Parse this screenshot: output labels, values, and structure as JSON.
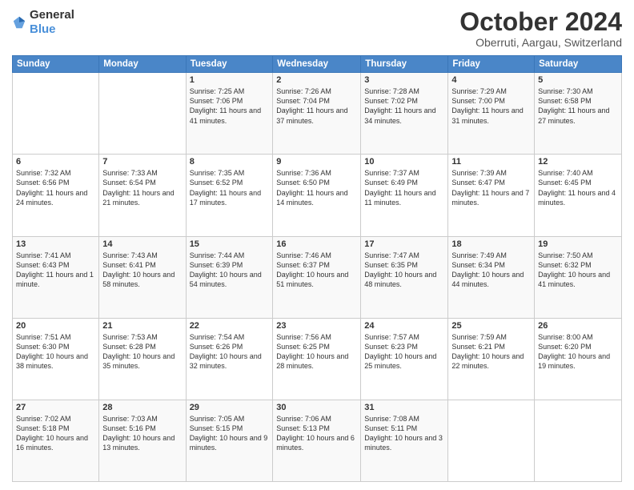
{
  "header": {
    "logo": {
      "general": "General",
      "blue": "Blue"
    },
    "title": "October 2024",
    "location": "Oberruti, Aargau, Switzerland"
  },
  "days_of_week": [
    "Sunday",
    "Monday",
    "Tuesday",
    "Wednesday",
    "Thursday",
    "Friday",
    "Saturday"
  ],
  "weeks": [
    [
      {
        "day": "",
        "sunrise": "",
        "sunset": "",
        "daylight": ""
      },
      {
        "day": "",
        "sunrise": "",
        "sunset": "",
        "daylight": ""
      },
      {
        "day": "1",
        "sunrise": "Sunrise: 7:25 AM",
        "sunset": "Sunset: 7:06 PM",
        "daylight": "Daylight: 11 hours and 41 minutes."
      },
      {
        "day": "2",
        "sunrise": "Sunrise: 7:26 AM",
        "sunset": "Sunset: 7:04 PM",
        "daylight": "Daylight: 11 hours and 37 minutes."
      },
      {
        "day": "3",
        "sunrise": "Sunrise: 7:28 AM",
        "sunset": "Sunset: 7:02 PM",
        "daylight": "Daylight: 11 hours and 34 minutes."
      },
      {
        "day": "4",
        "sunrise": "Sunrise: 7:29 AM",
        "sunset": "Sunset: 7:00 PM",
        "daylight": "Daylight: 11 hours and 31 minutes."
      },
      {
        "day": "5",
        "sunrise": "Sunrise: 7:30 AM",
        "sunset": "Sunset: 6:58 PM",
        "daylight": "Daylight: 11 hours and 27 minutes."
      }
    ],
    [
      {
        "day": "6",
        "sunrise": "Sunrise: 7:32 AM",
        "sunset": "Sunset: 6:56 PM",
        "daylight": "Daylight: 11 hours and 24 minutes."
      },
      {
        "day": "7",
        "sunrise": "Sunrise: 7:33 AM",
        "sunset": "Sunset: 6:54 PM",
        "daylight": "Daylight: 11 hours and 21 minutes."
      },
      {
        "day": "8",
        "sunrise": "Sunrise: 7:35 AM",
        "sunset": "Sunset: 6:52 PM",
        "daylight": "Daylight: 11 hours and 17 minutes."
      },
      {
        "day": "9",
        "sunrise": "Sunrise: 7:36 AM",
        "sunset": "Sunset: 6:50 PM",
        "daylight": "Daylight: 11 hours and 14 minutes."
      },
      {
        "day": "10",
        "sunrise": "Sunrise: 7:37 AM",
        "sunset": "Sunset: 6:49 PM",
        "daylight": "Daylight: 11 hours and 11 minutes."
      },
      {
        "day": "11",
        "sunrise": "Sunrise: 7:39 AM",
        "sunset": "Sunset: 6:47 PM",
        "daylight": "Daylight: 11 hours and 7 minutes."
      },
      {
        "day": "12",
        "sunrise": "Sunrise: 7:40 AM",
        "sunset": "Sunset: 6:45 PM",
        "daylight": "Daylight: 11 hours and 4 minutes."
      }
    ],
    [
      {
        "day": "13",
        "sunrise": "Sunrise: 7:41 AM",
        "sunset": "Sunset: 6:43 PM",
        "daylight": "Daylight: 11 hours and 1 minute."
      },
      {
        "day": "14",
        "sunrise": "Sunrise: 7:43 AM",
        "sunset": "Sunset: 6:41 PM",
        "daylight": "Daylight: 10 hours and 58 minutes."
      },
      {
        "day": "15",
        "sunrise": "Sunrise: 7:44 AM",
        "sunset": "Sunset: 6:39 PM",
        "daylight": "Daylight: 10 hours and 54 minutes."
      },
      {
        "day": "16",
        "sunrise": "Sunrise: 7:46 AM",
        "sunset": "Sunset: 6:37 PM",
        "daylight": "Daylight: 10 hours and 51 minutes."
      },
      {
        "day": "17",
        "sunrise": "Sunrise: 7:47 AM",
        "sunset": "Sunset: 6:35 PM",
        "daylight": "Daylight: 10 hours and 48 minutes."
      },
      {
        "day": "18",
        "sunrise": "Sunrise: 7:49 AM",
        "sunset": "Sunset: 6:34 PM",
        "daylight": "Daylight: 10 hours and 44 minutes."
      },
      {
        "day": "19",
        "sunrise": "Sunrise: 7:50 AM",
        "sunset": "Sunset: 6:32 PM",
        "daylight": "Daylight: 10 hours and 41 minutes."
      }
    ],
    [
      {
        "day": "20",
        "sunrise": "Sunrise: 7:51 AM",
        "sunset": "Sunset: 6:30 PM",
        "daylight": "Daylight: 10 hours and 38 minutes."
      },
      {
        "day": "21",
        "sunrise": "Sunrise: 7:53 AM",
        "sunset": "Sunset: 6:28 PM",
        "daylight": "Daylight: 10 hours and 35 minutes."
      },
      {
        "day": "22",
        "sunrise": "Sunrise: 7:54 AM",
        "sunset": "Sunset: 6:26 PM",
        "daylight": "Daylight: 10 hours and 32 minutes."
      },
      {
        "day": "23",
        "sunrise": "Sunrise: 7:56 AM",
        "sunset": "Sunset: 6:25 PM",
        "daylight": "Daylight: 10 hours and 28 minutes."
      },
      {
        "day": "24",
        "sunrise": "Sunrise: 7:57 AM",
        "sunset": "Sunset: 6:23 PM",
        "daylight": "Daylight: 10 hours and 25 minutes."
      },
      {
        "day": "25",
        "sunrise": "Sunrise: 7:59 AM",
        "sunset": "Sunset: 6:21 PM",
        "daylight": "Daylight: 10 hours and 22 minutes."
      },
      {
        "day": "26",
        "sunrise": "Sunrise: 8:00 AM",
        "sunset": "Sunset: 6:20 PM",
        "daylight": "Daylight: 10 hours and 19 minutes."
      }
    ],
    [
      {
        "day": "27",
        "sunrise": "Sunrise: 7:02 AM",
        "sunset": "Sunset: 5:18 PM",
        "daylight": "Daylight: 10 hours and 16 minutes."
      },
      {
        "day": "28",
        "sunrise": "Sunrise: 7:03 AM",
        "sunset": "Sunset: 5:16 PM",
        "daylight": "Daylight: 10 hours and 13 minutes."
      },
      {
        "day": "29",
        "sunrise": "Sunrise: 7:05 AM",
        "sunset": "Sunset: 5:15 PM",
        "daylight": "Daylight: 10 hours and 9 minutes."
      },
      {
        "day": "30",
        "sunrise": "Sunrise: 7:06 AM",
        "sunset": "Sunset: 5:13 PM",
        "daylight": "Daylight: 10 hours and 6 minutes."
      },
      {
        "day": "31",
        "sunrise": "Sunrise: 7:08 AM",
        "sunset": "Sunset: 5:11 PM",
        "daylight": "Daylight: 10 hours and 3 minutes."
      },
      {
        "day": "",
        "sunrise": "",
        "sunset": "",
        "daylight": ""
      },
      {
        "day": "",
        "sunrise": "",
        "sunset": "",
        "daylight": ""
      }
    ]
  ]
}
